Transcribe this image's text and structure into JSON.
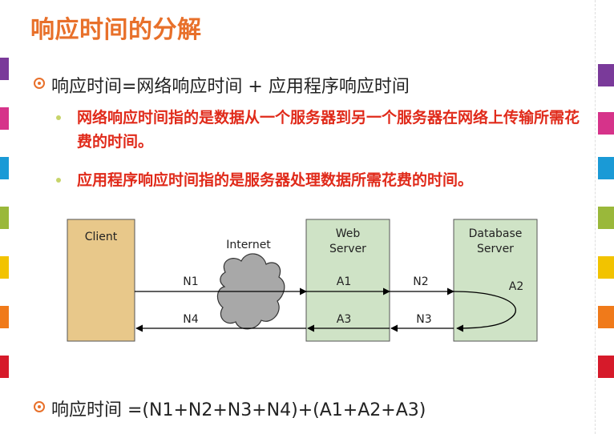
{
  "slide": {
    "title": "响应时间的分解",
    "bullet1": "响应时间=网络响应时间 + 应用程序响应时间",
    "sub1": "网络响应时间指的是数据从一个服务器到另一个服务器在网络上传输所需花费的时间。",
    "sub2": "应用程序响应时间指的是服务器处理数据所需花费的时间。",
    "bullet2": "响应时间 =(N1+N2+N3+N4)+(A1+A2+A3)"
  },
  "diagram": {
    "client_label": "Client",
    "internet_label": "Internet",
    "web_line1": "Web",
    "web_line2": "Server",
    "db_line1": "Database",
    "db_line2": "Server",
    "n1": "N1",
    "n2": "N2",
    "n3": "N3",
    "n4": "N4",
    "a1": "A1",
    "a2": "A2",
    "a3": "A3"
  },
  "colors": {
    "title": "#e8702a",
    "sub_text": "#e02a1a",
    "client_box": "#e8c88a",
    "server_box": "#cfe3c6",
    "stripes": [
      "#7a3a9a",
      "#d6338a",
      "#1a9ad6",
      "#9ab83a",
      "#f2c300",
      "#f07a1a",
      "#d61a2a"
    ]
  }
}
